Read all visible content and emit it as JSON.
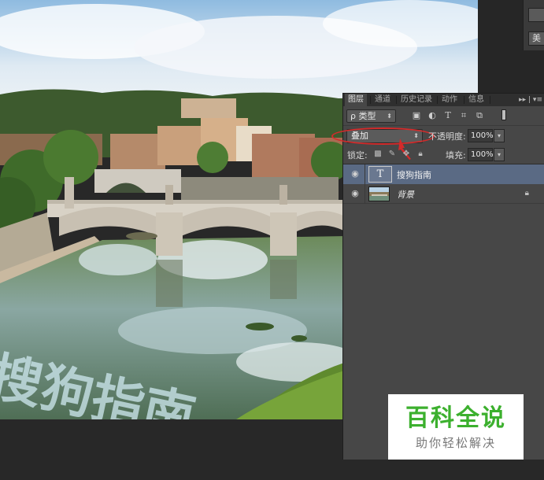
{
  "canvas": {
    "overlay_text": "搜狗指南",
    "overlay_color": "#cfe9f0"
  },
  "top_right": {
    "button_1": "",
    "button_2": "美"
  },
  "layers_panel": {
    "tabs": [
      {
        "label": "图层",
        "active": true
      },
      {
        "label": "通道",
        "active": false
      },
      {
        "label": "历史记录",
        "active": false
      },
      {
        "label": "动作",
        "active": false
      },
      {
        "label": "信息",
        "active": false
      }
    ],
    "collapse_icon": "double-chevron-right-icon",
    "menu_icon": "panel-menu-icon",
    "filter": {
      "search_icon": "ρ",
      "kind": "类型",
      "icons": [
        "image-filter-icon",
        "adjustment-filter-icon",
        "type-filter-icon",
        "shape-filter-icon",
        "smart-object-filter-icon"
      ]
    },
    "blend_mode": "叠加",
    "opacity_label": "不透明度:",
    "opacity_value": "100%",
    "lock_label": "锁定:",
    "fill_label": "填充:",
    "fill_value": "100%",
    "layers": [
      {
        "name": "搜狗指南",
        "type": "text",
        "thumb": "T",
        "selected": true,
        "visible": true
      },
      {
        "name": "背景",
        "type": "image",
        "selected": false,
        "visible": true,
        "locked": true
      }
    ],
    "highlight_color": "#d42a2a"
  },
  "logo": {
    "title": "百科全说",
    "subtitle": "助你轻松解决",
    "title_color": "#3cb02e"
  }
}
